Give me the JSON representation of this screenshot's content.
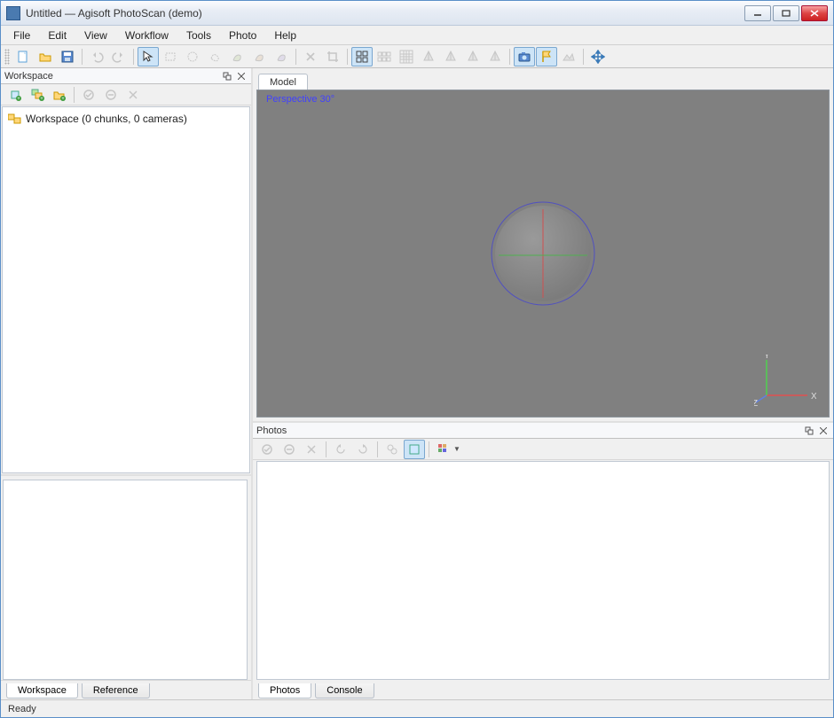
{
  "window": {
    "title": "Untitled — Agisoft PhotoScan (demo)"
  },
  "menu": [
    "File",
    "Edit",
    "View",
    "Workflow",
    "Tools",
    "Photo",
    "Help"
  ],
  "toolbar": [
    {
      "name": "new-document-icon",
      "disabled": false,
      "svg": "doc"
    },
    {
      "name": "open-folder-icon",
      "disabled": false,
      "svg": "folder"
    },
    {
      "name": "save-icon",
      "disabled": false,
      "svg": "save"
    },
    {
      "sep": true
    },
    {
      "name": "undo-icon",
      "disabled": true,
      "svg": "undo"
    },
    {
      "name": "redo-icon",
      "disabled": true,
      "svg": "redo"
    },
    {
      "sep": true
    },
    {
      "name": "arrow-select-icon",
      "disabled": false,
      "svg": "arrow",
      "active": true
    },
    {
      "name": "rect-select-icon",
      "disabled": true,
      "svg": "rect"
    },
    {
      "name": "circle-select-icon",
      "disabled": true,
      "svg": "circle"
    },
    {
      "name": "freeform-select-icon",
      "disabled": true,
      "svg": "freeform"
    },
    {
      "name": "resize-region-icon",
      "disabled": true,
      "svg": "grow"
    },
    {
      "name": "rotate-region-icon",
      "disabled": true,
      "svg": "shrink"
    },
    {
      "name": "move-region-icon",
      "disabled": true,
      "svg": "blob"
    },
    {
      "sep": true
    },
    {
      "name": "delete-icon",
      "disabled": true,
      "svg": "x"
    },
    {
      "name": "crop-icon",
      "disabled": true,
      "svg": "crop"
    },
    {
      "sep": true
    },
    {
      "name": "show-cameras-icon",
      "disabled": false,
      "svg": "grid4",
      "active": true
    },
    {
      "name": "show-markers-icon",
      "disabled": true,
      "svg": "grid6"
    },
    {
      "name": "show-aligned-icon",
      "disabled": true,
      "svg": "grid16"
    },
    {
      "name": "point-cloud-icon",
      "disabled": true,
      "svg": "tet1"
    },
    {
      "name": "dense-cloud-icon",
      "disabled": true,
      "svg": "tet2"
    },
    {
      "name": "model-shaded-icon",
      "disabled": true,
      "svg": "tet3"
    },
    {
      "name": "model-solid-icon",
      "disabled": true,
      "svg": "tet4"
    },
    {
      "sep": true
    },
    {
      "name": "show-images-icon",
      "disabled": false,
      "svg": "camera",
      "active": true
    },
    {
      "name": "show-labels-icon",
      "disabled": false,
      "svg": "flag",
      "active": true
    },
    {
      "name": "show-tracks-icon",
      "disabled": true,
      "svg": "dem"
    },
    {
      "sep": true
    },
    {
      "name": "navigation-icon",
      "disabled": false,
      "svg": "move"
    }
  ],
  "workspace": {
    "title": "Workspace",
    "tree_root": "Workspace (0 chunks, 0 cameras)",
    "tabs": [
      "Workspace",
      "Reference"
    ],
    "active_tab": 0
  },
  "model": {
    "tab_label": "Model",
    "viewport_label": "Perspective 30°",
    "axes": {
      "x": "X",
      "y": "Y",
      "z": "Z"
    }
  },
  "photos": {
    "title": "Photos",
    "tabs": [
      "Photos",
      "Console"
    ],
    "active_tab": 0
  },
  "status": "Ready"
}
